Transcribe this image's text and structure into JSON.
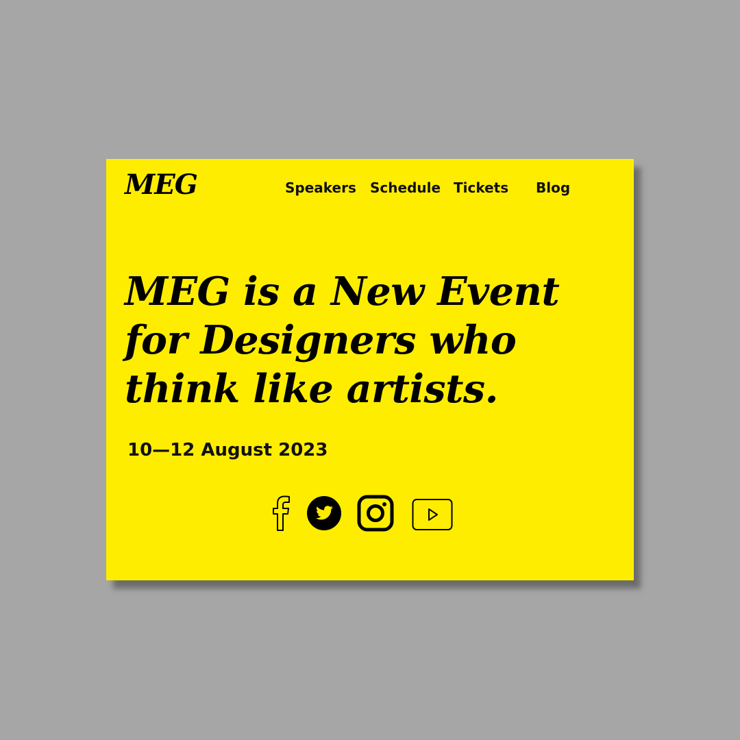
{
  "brand": {
    "logo": "MEG",
    "background": "#a6a6a6",
    "card_color": "#ffed00",
    "text_color": "#000000"
  },
  "nav": {
    "items": [
      {
        "label": "Speakers"
      },
      {
        "label": "Schedule"
      },
      {
        "label": "Tickets"
      },
      {
        "label": "Blog"
      }
    ]
  },
  "hero": {
    "headline_lines": [
      "MEG is a New Event",
      "for Designers who",
      "think like artists."
    ],
    "date": "10—12 August 2023"
  },
  "social": {
    "icons": [
      "facebook-icon",
      "twitter-icon",
      "instagram-icon",
      "youtube-icon"
    ]
  }
}
